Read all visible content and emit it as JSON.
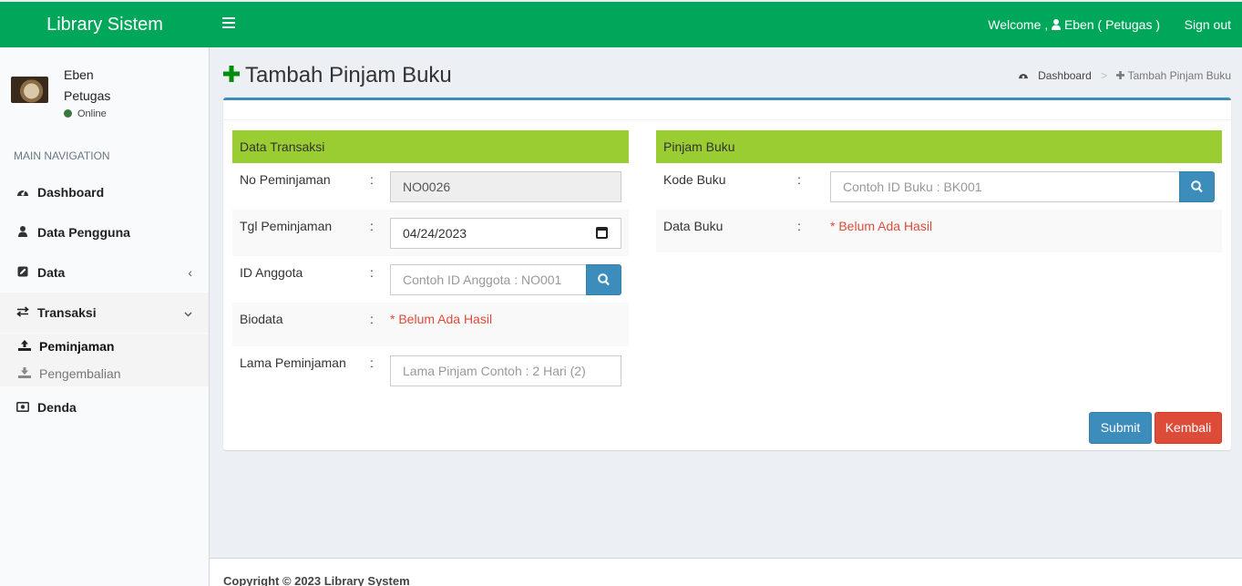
{
  "header": {
    "logo": "Library Sistem",
    "welcome": "Welcome ,",
    "user_display": "Eben ( Petugas )",
    "signout": "Sign out"
  },
  "sidebar": {
    "user_name": "Eben",
    "user_role": "Petugas",
    "status": "Online",
    "nav_header": "MAIN NAVIGATION",
    "items": [
      {
        "label": "Dashboard",
        "icon": "dashboard-icon"
      },
      {
        "label": "Data Pengguna",
        "icon": "user-icon"
      },
      {
        "label": "Data",
        "icon": "edit-icon"
      },
      {
        "label": "Transaksi",
        "icon": "exchange-icon"
      },
      {
        "label": "Denda",
        "icon": "money-icon"
      }
    ],
    "submenu": [
      {
        "label": "Peminjaman",
        "icon": "upload-icon"
      },
      {
        "label": "Pengembalian",
        "icon": "download-icon"
      }
    ]
  },
  "page": {
    "title": "Tambah Pinjam Buku",
    "breadcrumb": [
      {
        "label": "Dashboard"
      },
      {
        "label": "Tambah Pinjam Buku"
      }
    ]
  },
  "form_left": {
    "heading": "Data Transaksi",
    "no_label": "No Peminjaman",
    "no_value": "NO0026",
    "tgl_label": "Tgl Peminjaman",
    "tgl_value": "04/24/2023",
    "id_label": "ID Anggota",
    "id_placeholder": "Contoh ID Anggota : NO001",
    "bio_label": "Biodata",
    "bio_value": "* Belum Ada Hasil",
    "lama_label": "Lama Peminjaman",
    "lama_placeholder": "Lama Pinjam Contoh : 2 Hari (2)"
  },
  "form_right": {
    "heading": "Pinjam Buku",
    "kode_label": "Kode Buku",
    "kode_placeholder": "Contoh ID Buku : BK001",
    "data_label": "Data Buku",
    "data_value": "* Belum Ada Hasil"
  },
  "colon": ":",
  "buttons": {
    "submit": "Submit",
    "back": "Kembali"
  },
  "footer": {
    "text": "Copyright © 2023 Library System"
  },
  "colors": {
    "header": "#00a65a",
    "panel_head": "#9acd32",
    "primary": "#3c8dbc",
    "danger": "#dd4b39"
  }
}
